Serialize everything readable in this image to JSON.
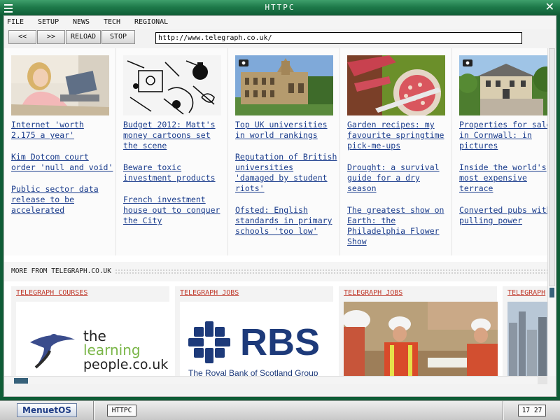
{
  "window": {
    "title": "HTTPC"
  },
  "menu": [
    "FILE",
    "SETUP",
    "NEWS",
    "TECH",
    "REGIONAL"
  ],
  "toolbar": {
    "back": "<<",
    "forward": ">>",
    "reload": "RELOAD",
    "stop": "STOP"
  },
  "address": {
    "url": "http://www.telegraph.co.uk/"
  },
  "columns": [
    {
      "links": [
        "Internet 'worth\n2.175 a year'",
        "Kim Dotcom court\norder 'null and void'",
        "Public sector data\nrelease to be\naccelerated"
      ]
    },
    {
      "links": [
        "Budget 2012: Matt's\nmoney cartoons set\nthe scene",
        "Beware toxic\ninvestment products",
        "French investment\nhouse out to conquer\nthe City"
      ]
    },
    {
      "links": [
        "Top UK universities\nin world rankings",
        "Reputation of British\nuniversities\n'damaged by student\nriots'",
        "Ofsted: English\nstandards in primary\nschools 'too low'"
      ]
    },
    {
      "links": [
        "Garden recipes: my\nfavourite springtime\npick-me-ups",
        "Drought: a survival\nguide for a dry\nseason",
        "The greatest show on\nEarth: the\nPhiladelphia Flower\nShow"
      ]
    },
    {
      "links": [
        "Properties for sale\nin Cornwall: in\npictures",
        "Inside the world's\nmost expensive\nterrace",
        "Converted pubs with\npulling power"
      ]
    }
  ],
  "more": {
    "label": "MORE FROM TELEGRAPH.CO.UK"
  },
  "promos": [
    {
      "label": "TELEGRAPH COURSES",
      "logo_the": "the",
      "logo_learning": "learning",
      "logo_people": "people.co.uk"
    },
    {
      "label": "TELEGRAPH JOBS",
      "logo_rbs": "RBS",
      "logo_sub": "The Royal Bank of Scotland Group"
    },
    {
      "label": "TELEGRAPH JOBS"
    },
    {
      "label": "TELEGRAPH"
    }
  ],
  "taskbar": {
    "start": "MenuetOS",
    "task": "HTTPC",
    "clock": "17 27"
  },
  "colors": {
    "link": "#1a3c8c",
    "promo_label": "#c0392b",
    "window": "#0f5c36"
  }
}
